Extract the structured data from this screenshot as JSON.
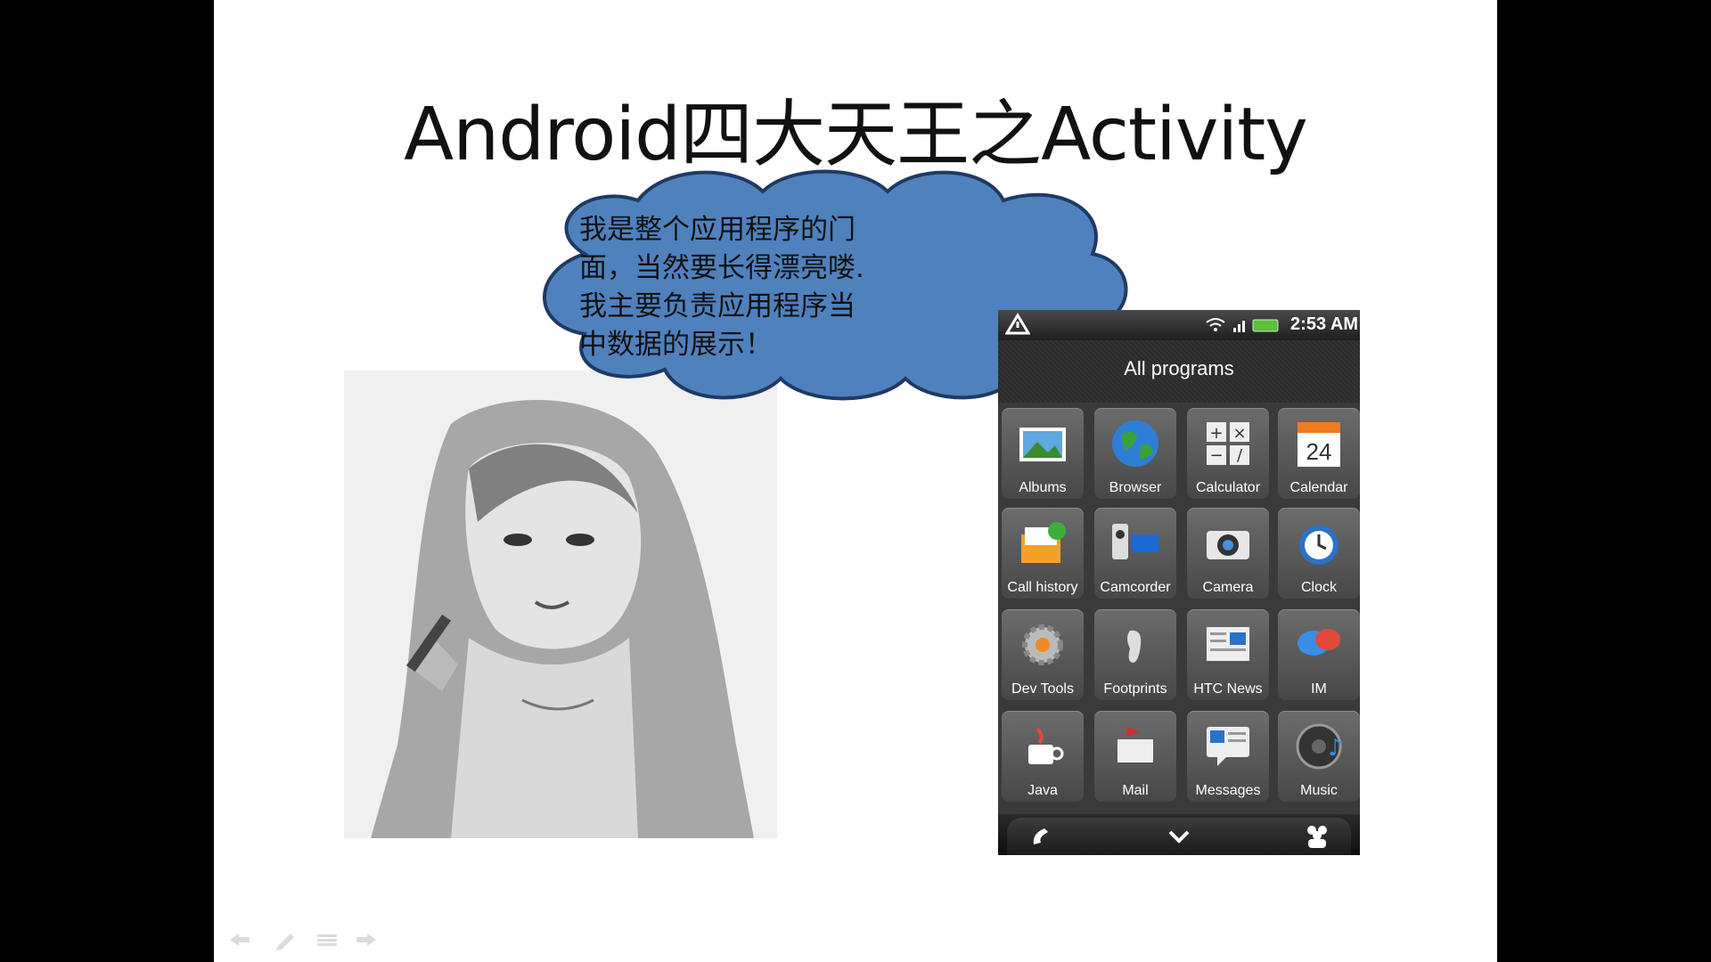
{
  "slide": {
    "title": "Android四大天王之Activity",
    "speech_bubble_text": "我是整个应用程序的门\n面，当然要长得漂亮喽.\n我主要负责应用程序当\n中数据的展示！"
  },
  "phone": {
    "status_time": "2:53 AM",
    "header_title": "All programs",
    "apps": [
      {
        "label": "Albums",
        "icon": "albums-icon"
      },
      {
        "label": "Browser",
        "icon": "browser-icon"
      },
      {
        "label": "Calculator",
        "icon": "calculator-icon"
      },
      {
        "label": "Calendar",
        "icon": "calendar-icon",
        "icon_text": "24"
      },
      {
        "label": "Call history",
        "icon": "call-history-icon"
      },
      {
        "label": "Camcorder",
        "icon": "camcorder-icon"
      },
      {
        "label": "Camera",
        "icon": "camera-icon"
      },
      {
        "label": "Clock",
        "icon": "clock-icon"
      },
      {
        "label": "Dev Tools",
        "icon": "dev-tools-icon"
      },
      {
        "label": "Footprints",
        "icon": "footprints-icon"
      },
      {
        "label": "HTC News",
        "icon": "htc-news-icon"
      },
      {
        "label": "IM",
        "icon": "im-icon"
      },
      {
        "label": "Java",
        "icon": "java-icon"
      },
      {
        "label": "Mail",
        "icon": "mail-icon"
      },
      {
        "label": "Messages",
        "icon": "messages-icon"
      },
      {
        "label": "Music",
        "icon": "music-icon"
      }
    ],
    "dock": [
      "phone-icon",
      "chevron-down-icon",
      "people-icon"
    ]
  },
  "colors": {
    "cloud_fill": "#4f81bd",
    "cloud_stroke": "#1f3a63",
    "phone_bg": "#1a1a1a"
  }
}
